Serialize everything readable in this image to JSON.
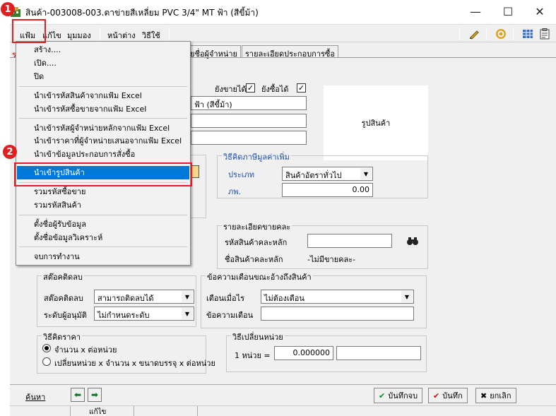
{
  "window": {
    "title": "สินค้า-003008-003.ตาข่ายสีเหลี่ยม PVC 3/4\" MT ฟ้า (สีขี้ม้า)",
    "minimize": "—",
    "maximize": "☐",
    "close": "✕"
  },
  "menubar": {
    "items": [
      "แฟ้ม",
      "แก้ไข",
      "มุมมอง",
      "หน้าต่าง",
      "วิธีใช้"
    ]
  },
  "toolbar": {
    "icons": [
      "pen-icon",
      "target-icon",
      "grid-icon",
      "clipboard-icon"
    ]
  },
  "tabs": {
    "visible_prefix": "ร",
    "items": [
      "ยชื่อผู้จำหน่าย",
      "รายละเอียดประกอบการซื้อ"
    ]
  },
  "file_menu": {
    "items": [
      "สร้าง....",
      "เปิด....",
      "ปิด",
      "นำเข้ารหัสสินค้าจากแฟ้ม Excel",
      "นำเข้ารหัสซื้อขายจากแฟ้ม Excel",
      "นำเข้ารหัสผู้จำหน่ายหลักจากแฟ้ม Excel",
      "นำเข้าราคาที่ผู้จำหน่ายเสนอจากแฟ้ม Excel",
      "นำเข้าข้อมูลประกอบการสั่งซื้อ",
      "นำเข้ารูปสินค้า",
      "รวมรหัสซื้อขาย",
      "รวมรหัสสินค้า",
      "ตั้งชื่อผู้รับข้อมูล",
      "ตั้งชื่อข้อมูลวิเคราะห์",
      "จบการทำงาน"
    ],
    "selected": "นำเข้ารูปสินค้า"
  },
  "annotations": {
    "step1": "1",
    "step2": "2"
  },
  "general": {
    "can_sell_label": "ยังขายได้",
    "can_sell": true,
    "can_buy_label": "ยังซื้อได้",
    "can_buy": true,
    "name_field": "ฟ้า (สีขี้ม้า)",
    "photo_label": "รูปสินค้า"
  },
  "vat": {
    "title": "วิธีคิดภาษีมูลค่าเพิ่ม",
    "type_label": "ประเภท",
    "type_value": "สินค้าอัตราทั่วไป",
    "rate_label": "ภพ.",
    "rate_value": "0.00"
  },
  "bundle": {
    "title": "รายละเอียดขายคละ",
    "code_label": "รหัสสินค้าคละหลัก",
    "code_value": "",
    "name_label": "ชื่อสินค้าคละหลัก",
    "name_value": "-ไม่มีขายคละ-"
  },
  "stock": {
    "title": "สต๊อคติดลบ",
    "mode_label": "สต๊อคติดลบ",
    "mode_value": "สามารถติดลบได้",
    "level_label": "ระดับผู้อนุมัติ",
    "level_value": "ไม่กำหนดระดับ"
  },
  "warning": {
    "title": "ข้อความเตือนขณะอ้างถึงสินค้า",
    "when_label": "เตือนเมื่อไร",
    "when_value": "ไม่ต้องเตือน",
    "message_label": "ข้อความเตือน",
    "message_value": ""
  },
  "pricing": {
    "title": "วิธีคิดราคา",
    "option1": "จำนวน x ต่อหน่วย",
    "option2": "เปลี่ยนหน่วย x จำนวน x ขนาดบรรจุ x ต่อหน่วย",
    "selected": 1
  },
  "unit": {
    "title": "วิธีเปลี่ยนหน่วย",
    "label": "1 หน่วย =",
    "value": "0.000000",
    "unit_value": ""
  },
  "bottom": {
    "search": "ค้นหา",
    "save_close": "บันทึกจบ",
    "save": "บันทึก",
    "cancel": "ยกเลิก"
  },
  "status": {
    "mode": "แก้ไข"
  }
}
